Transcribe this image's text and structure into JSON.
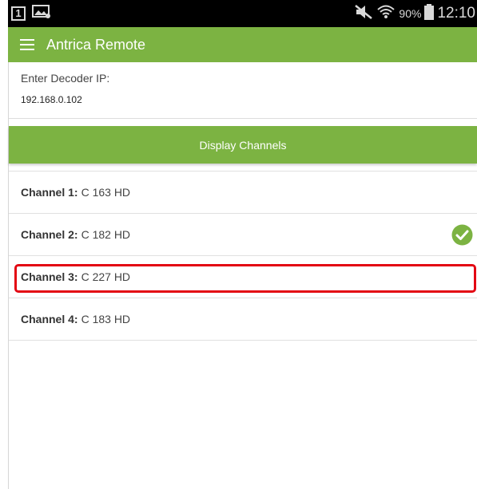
{
  "status_bar": {
    "notification_count": "1",
    "battery_percent": "90%",
    "time": "12:10",
    "icons": [
      "notification-count-icon",
      "image-notification-icon",
      "mute-icon",
      "wifi-icon",
      "battery-icon"
    ]
  },
  "app_bar": {
    "title": "Antrica Remote",
    "menu_icon": "hamburger-menu-icon",
    "color": "#7cb342"
  },
  "decoder": {
    "label": "Enter Decoder IP:",
    "value": "192.168.0.102"
  },
  "display_button": {
    "label": "Display Channels"
  },
  "channels": [
    {
      "label": "Channel 1:",
      "value": "C 163 HD",
      "selected": false
    },
    {
      "label": "Channel 2:",
      "value": "C 182 HD",
      "selected": true
    },
    {
      "label": "Channel 3:",
      "value": "C 227 HD",
      "selected": false,
      "highlighted": true
    },
    {
      "label": "Channel 4:",
      "value": "C 183 HD",
      "selected": false
    }
  ],
  "colors": {
    "accent": "#7cb342",
    "highlight": "#e30613"
  }
}
